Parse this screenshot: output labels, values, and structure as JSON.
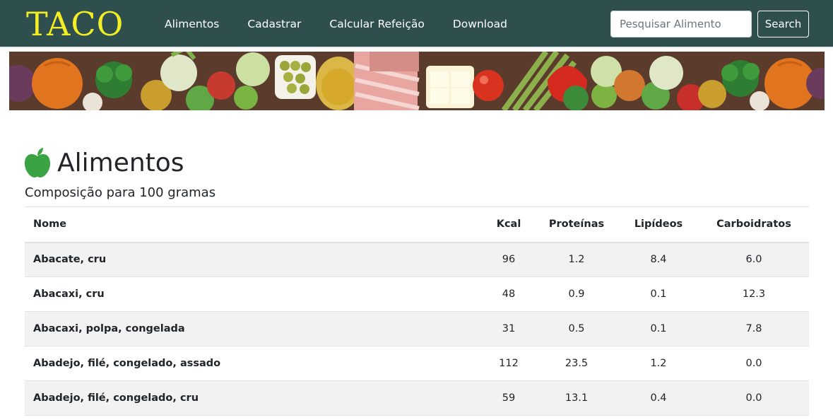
{
  "navbar": {
    "brand": "TACO",
    "links": [
      "Alimentos",
      "Cadastrar",
      "Calcular Refeição",
      "Download"
    ],
    "search_placeholder": "Pesquisar Alimento",
    "search_button": "Search",
    "background": "#2f4f4f",
    "brand_color": "#f2ee23"
  },
  "banner": {
    "icon": "vegetables-banner-image"
  },
  "main": {
    "title": "Alimentos",
    "title_icon": "apple-icon",
    "subtitle": "Composição para 100 gramas",
    "table": {
      "headers": [
        "Nome",
        "Kcal",
        "Proteínas",
        "Lipídeos",
        "Carboidratos"
      ],
      "rows": [
        [
          "Abacate, cru",
          "96",
          "1.2",
          "8.4",
          "6.0"
        ],
        [
          "Abacaxi, cru",
          "48",
          "0.9",
          "0.1",
          "12.3"
        ],
        [
          "Abacaxi, polpa, congelada",
          "31",
          "0.5",
          "0.1",
          "7.8"
        ],
        [
          "Abadejo, filé, congelado, assado",
          "112",
          "23.5",
          "1.2",
          "0.0"
        ],
        [
          "Abadejo, filé, congelado, cru",
          "59",
          "13.1",
          "0.4",
          "0.0"
        ]
      ]
    }
  }
}
